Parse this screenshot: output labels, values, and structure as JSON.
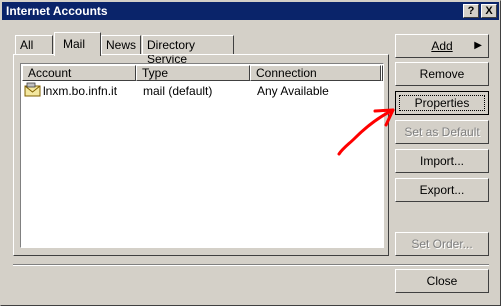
{
  "window": {
    "title": "Internet Accounts",
    "help_glyph": "?",
    "close_glyph": "X"
  },
  "tabs": [
    {
      "label": "All"
    },
    {
      "label": "Mail"
    },
    {
      "label": "News"
    },
    {
      "label": "Directory Service"
    }
  ],
  "list": {
    "columns": [
      "Account",
      "Type",
      "Connection"
    ],
    "rows": [
      {
        "account": "lnxm.bo.infn.it",
        "type": "mail (default)",
        "connection": "Any Available"
      }
    ]
  },
  "buttons": {
    "add": "Add",
    "add_arrow": "▶",
    "remove": "Remove",
    "properties": "Properties",
    "set_default": "Set as Default",
    "import": "Import...",
    "export": "Export...",
    "set_order": "Set Order...",
    "close": "Close"
  },
  "annotation": {
    "color": "#ff0000"
  }
}
